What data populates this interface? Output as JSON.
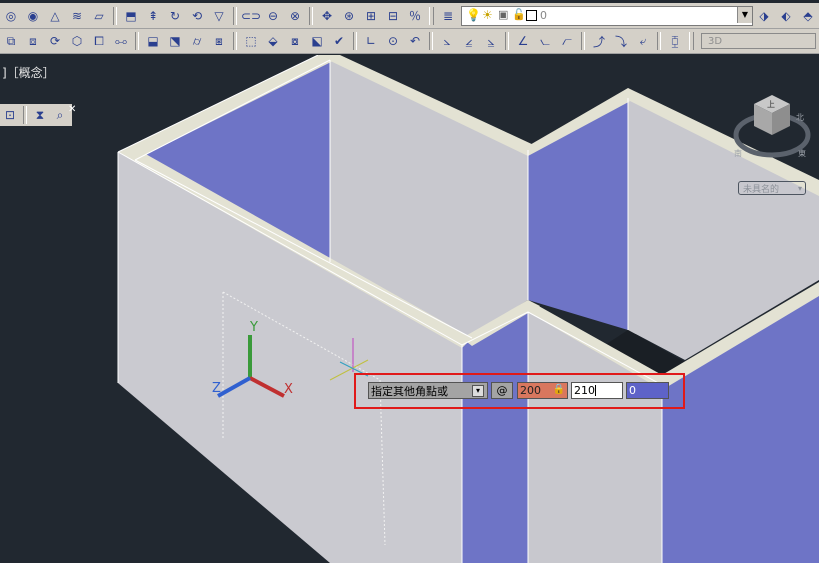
{
  "toolbar_top": {
    "layer_value": "0"
  },
  "toolbar_bottom": {
    "workspace_value": "3D"
  },
  "viewport": {
    "label": "]［概念］"
  },
  "viewcube": {
    "top_label": "上",
    "north_label": "北",
    "east_label": "東",
    "south_label": "南",
    "named_view": "未具名的"
  },
  "ucs_icon": {
    "x_label": "X",
    "y_label": "Y",
    "z_label": "Z"
  },
  "dynamic_input": {
    "prompt": "指定其他角點或",
    "at_symbol": "@",
    "x_value": "200",
    "y_value": "210",
    "z_value": "0"
  },
  "colors": {
    "background": "#212830",
    "wall_face": "#c9c9cf",
    "wall_top": "#e3e2d3",
    "interior_face": "#6e74c6",
    "highlight": "#e01a1a"
  }
}
